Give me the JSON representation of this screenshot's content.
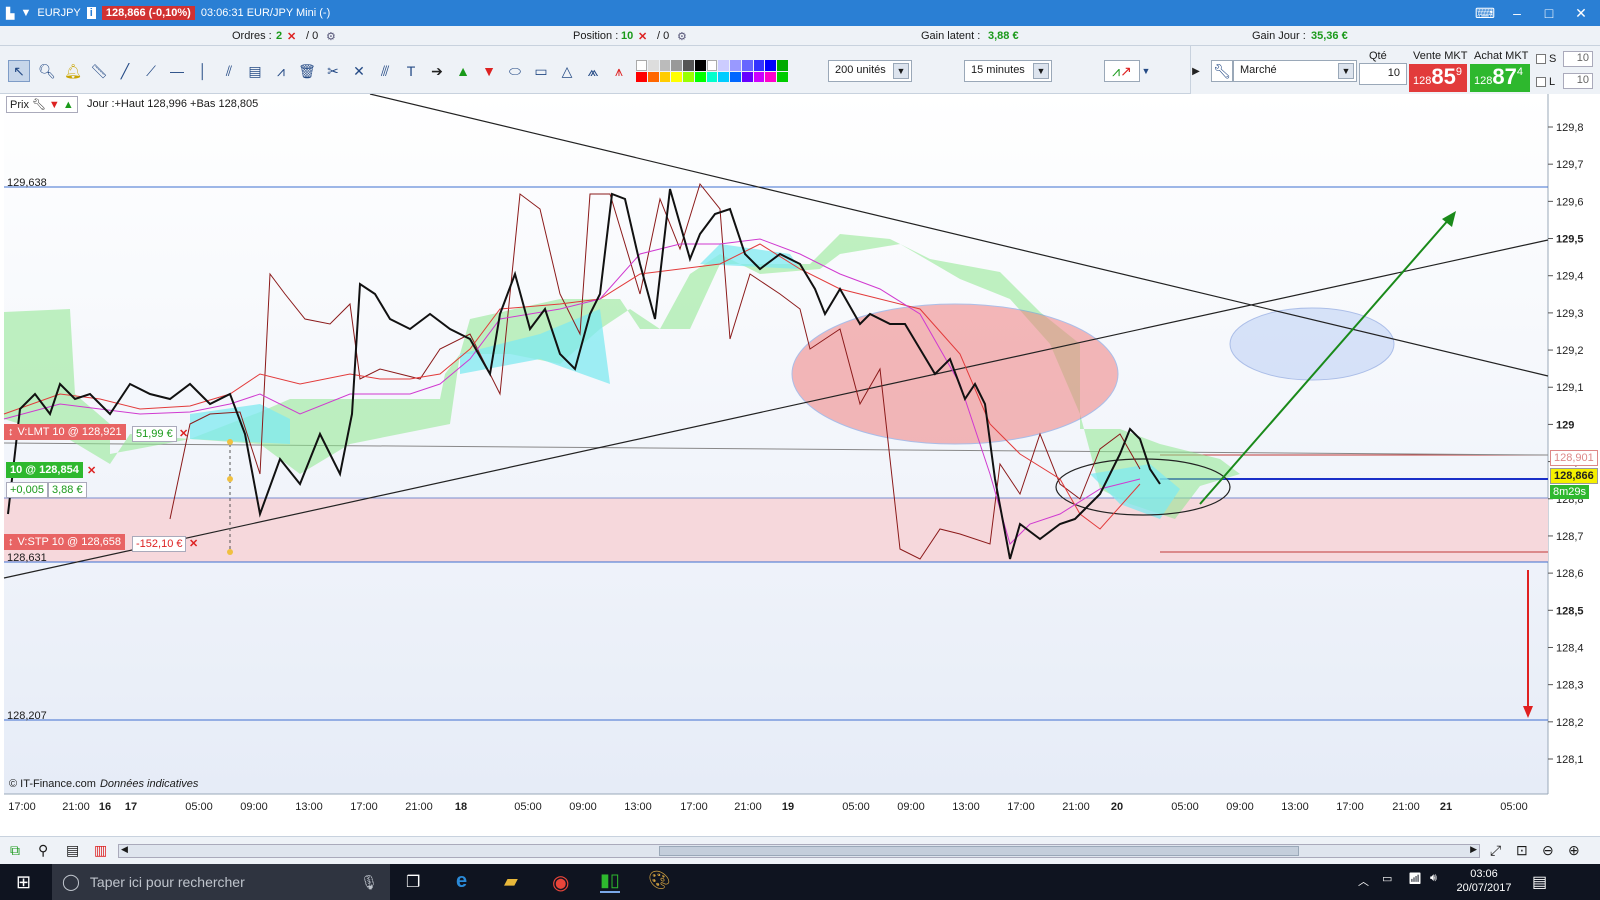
{
  "window": {
    "symbol": "EURJPY",
    "price_chip": "128,866 (-0,10%)",
    "title_rest": "03:06:31 EUR/JPY Mini (-)"
  },
  "infobar": {
    "orders_label": "Ordres :",
    "orders_value": "2",
    "orders_zero": "/ 0",
    "position_label": "Position :",
    "position_value": "10",
    "position_zero": "/ 0",
    "gain_latent_label": "Gain latent :",
    "gain_latent_value": "3,88 €",
    "gain_jour_label": "Gain Jour :",
    "gain_jour_value": "35,36 €"
  },
  "toolbar": {
    "units": "200 unités",
    "timeframe": "15 minutes",
    "order_type": "Marché",
    "qty_label": "Qté",
    "qty_value": "10",
    "sell_label": "Vente MKT",
    "sell_small": "128",
    "sell_big": "85",
    "sell_sup": "9",
    "buy_label": "Achat MKT",
    "buy_small": "128",
    "buy_big": "87",
    "buy_sup": "4",
    "s_label": "S",
    "s_value": "10",
    "l_label": "L",
    "l_value": "10"
  },
  "chart": {
    "prix_label": "Prix",
    "day_info": "Jour :+Haut 128,996 +Bas 128,805",
    "level_high": "129,638",
    "level_low1": "128,631",
    "level_low2": "128,207",
    "lmt_order": "V:LMT  10 @ 128,921",
    "lmt_gain": "51,99 €",
    "position_tag": "10 @ 128,854",
    "pos_diff": "+0,005",
    "pos_gain": "3,88 €",
    "stp_order": "V:STP  10 @ 128,658",
    "stp_loss": "-152,10 €",
    "current_price": "128,866",
    "price_red_tag": "128,901",
    "countdown": "8m29s",
    "footer": "© IT-Finance.com",
    "footer_italic": "Données indicatives",
    "y_ticks": [
      "129,8",
      "129,7",
      "129,6",
      "129,5",
      "129,4",
      "129,3",
      "129,2",
      "129,1",
      "129",
      "128,9",
      "128,8",
      "128,7",
      "128,6",
      "128,5",
      "128,4",
      "128,3",
      "128,2",
      "128,1"
    ],
    "x_ticks": [
      "17:00",
      "21:00",
      "16",
      "17",
      "05:00",
      "09:00",
      "13:00",
      "17:00",
      "21:00",
      "18",
      "05:00",
      "09:00",
      "13:00",
      "17:00",
      "21:00",
      "19",
      "05:00",
      "09:00",
      "13:00",
      "17:00",
      "21:00",
      "20",
      "05:00",
      "09:00",
      "13:00",
      "17:00",
      "21:00",
      "21",
      "05:00"
    ],
    "colors": {
      "ichimoku_up": "#8ee88e",
      "ichimoku_down": "#7fe9f0",
      "ellipse_red": "#f08080",
      "ellipse_blue": "#bcd0f5",
      "arrow_green": "#1a8a1a",
      "arrow_red": "#e02020"
    }
  },
  "taskbar": {
    "search_placeholder": "Taper ici pour rechercher",
    "time": "03:06",
    "date": "20/07/2017"
  }
}
